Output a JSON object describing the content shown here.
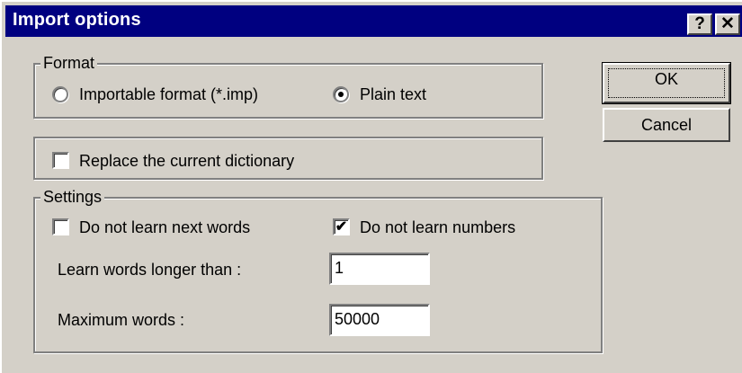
{
  "window": {
    "title": "Import options",
    "help_label": "?",
    "close_label": "✕",
    "help_icon": "question-mark-icon",
    "close_icon": "close-icon"
  },
  "format": {
    "legend": "Format",
    "options": [
      {
        "label": "Importable format (*.imp)",
        "selected": false
      },
      {
        "label": "Plain text",
        "selected": true
      }
    ]
  },
  "replace": {
    "label": "Replace the current dictionary",
    "checked": false
  },
  "settings": {
    "legend": "Settings",
    "no_learn_next": {
      "label": "Do not learn next words",
      "checked": false
    },
    "no_learn_numbers": {
      "label": "Do not learn numbers",
      "checked": true,
      "mark": "✔"
    },
    "longer_than": {
      "label": "Learn words longer than :",
      "value": "1"
    },
    "max_words": {
      "label": "Maximum words :",
      "value": "50000"
    }
  },
  "buttons": {
    "ok": "OK",
    "cancel": "Cancel"
  },
  "colors": {
    "titlebar": "#000080",
    "face": "#d4d0c8"
  }
}
